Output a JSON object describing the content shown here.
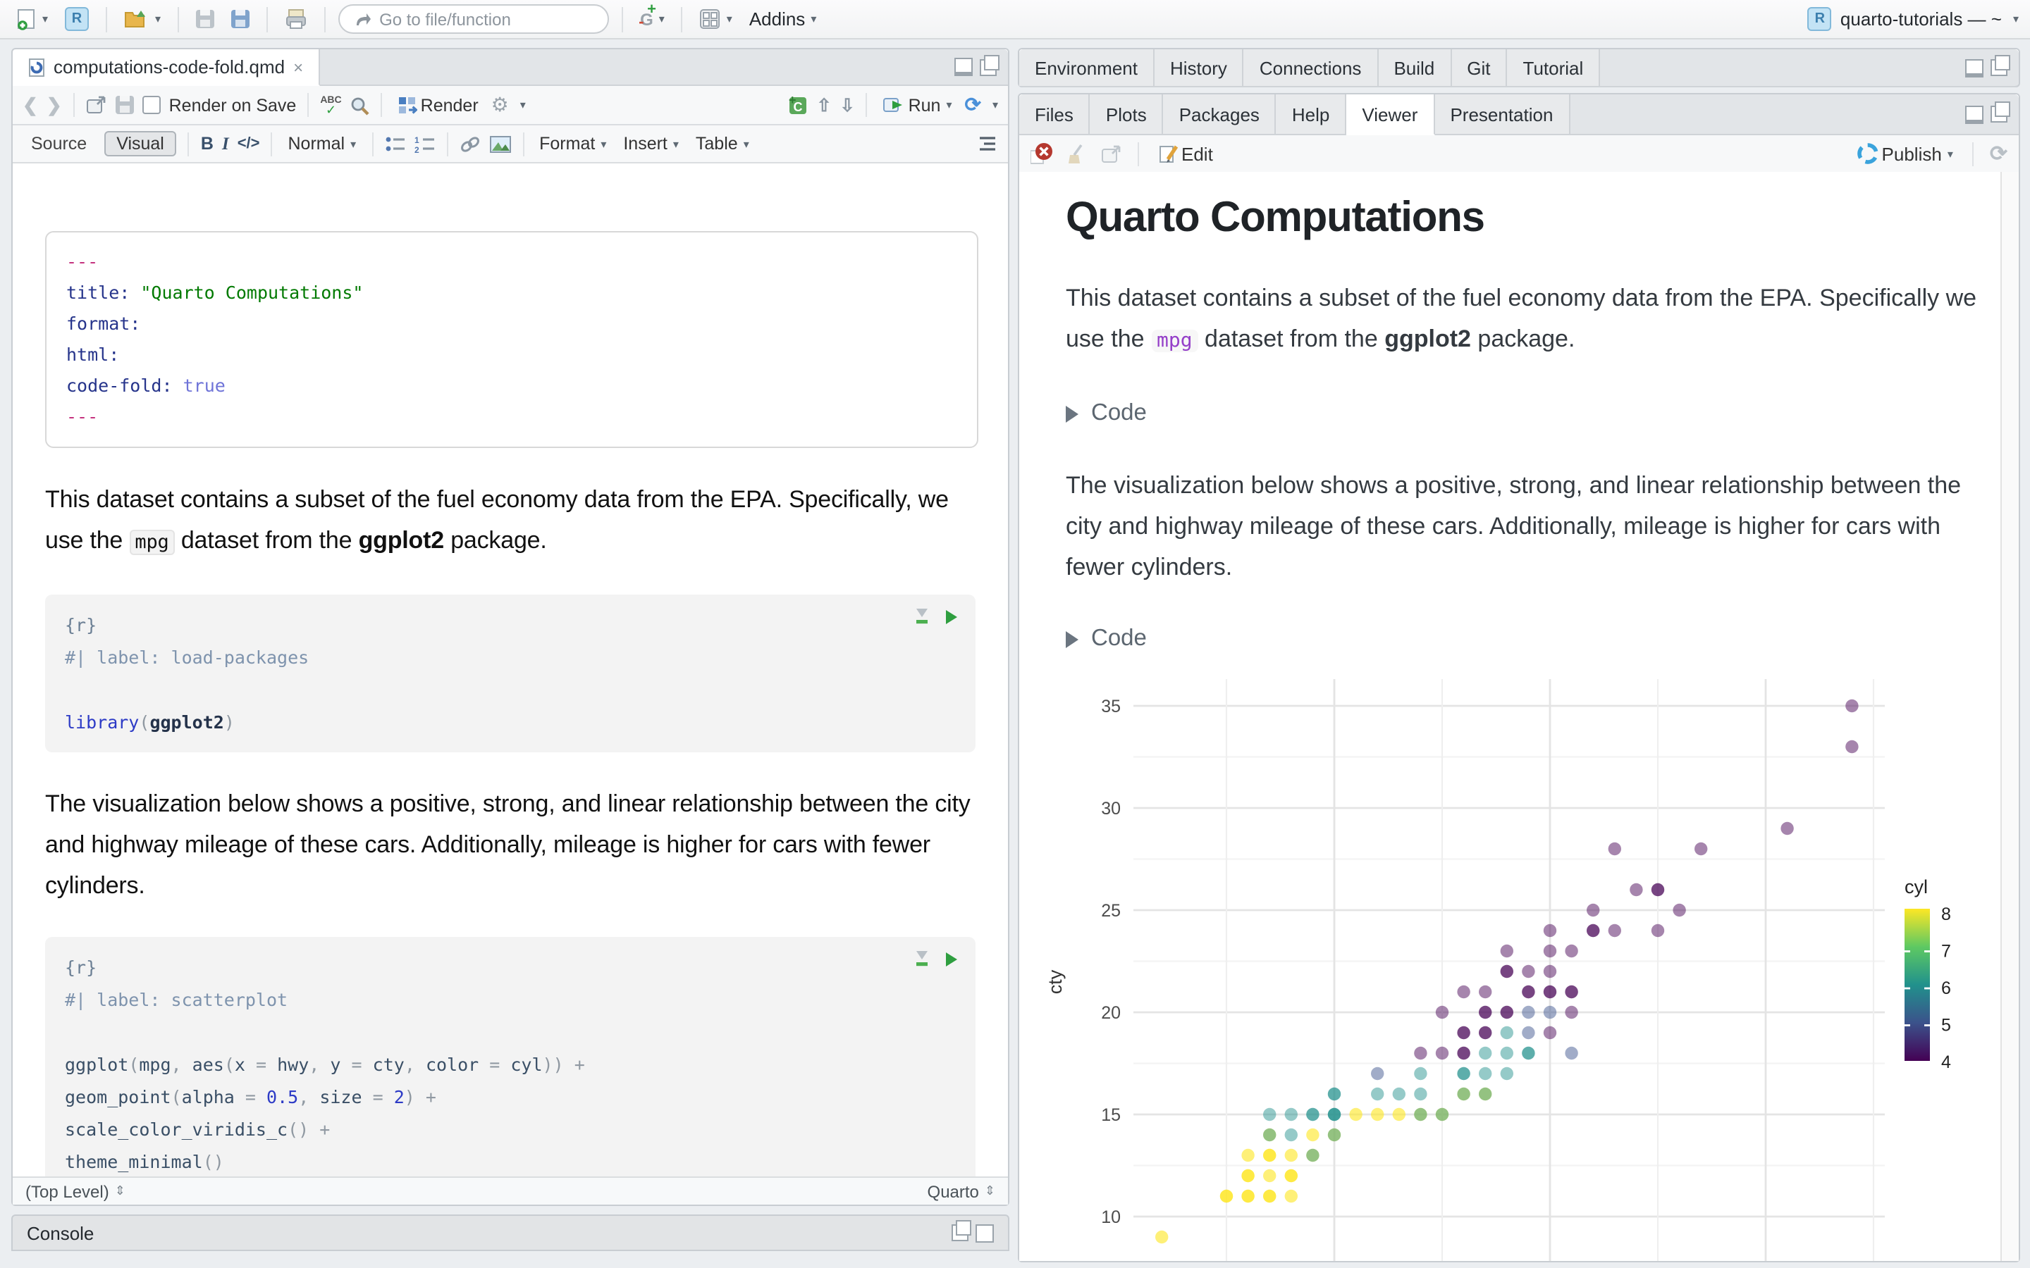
{
  "toolbar": {
    "goto_placeholder": "Go to file/function",
    "addins_label": "Addins",
    "project_label": "quarto-tutorials — ~"
  },
  "editor": {
    "tab_title": "computations-code-fold.qmd",
    "toolbar1": {
      "render_on_save": "Render on Save",
      "render": "Render",
      "run": "Run"
    },
    "toolbar2": {
      "source": "Source",
      "visual": "Visual",
      "bold": "B",
      "italic": "I",
      "code": "</>",
      "style": "Normal",
      "format": "Format",
      "insert": "Insert",
      "table": "Table"
    },
    "yaml_lines": [
      [
        {
          "t": "---",
          "c": "mg"
        }
      ],
      [
        {
          "t": "title: ",
          "c": "key"
        },
        {
          "t": "\"Quarto Computations\"",
          "c": "str"
        }
      ],
      [
        {
          "t": "format:",
          "c": "key"
        }
      ],
      [
        {
          "t": "  html:",
          "c": "key"
        }
      ],
      [
        {
          "t": "    code-fold: ",
          "c": "key"
        },
        {
          "t": "true",
          "c": "bool"
        }
      ],
      [
        {
          "t": "---",
          "c": "mg"
        }
      ]
    ],
    "para1": [
      {
        "t": "This dataset contains a subset of the fuel economy data from the EPA. Specifically, we use the "
      },
      {
        "t": "mpg",
        "s": "code"
      },
      {
        "t": " dataset from the "
      },
      {
        "t": "ggplot2",
        "s": "b"
      },
      {
        "t": " package."
      }
    ],
    "chunk1_lines": [
      [
        {
          "t": "{r}",
          "c": "hdr"
        }
      ],
      [
        {
          "t": "#| label: load-packages",
          "c": "cm"
        }
      ],
      [],
      [
        {
          "t": "library",
          "c": "fn"
        },
        {
          "t": "(",
          "c": "pa"
        },
        {
          "t": "ggplot2",
          "c": "idb"
        },
        {
          "t": ")",
          "c": "pa"
        }
      ]
    ],
    "para2": [
      {
        "t": "The visualization below shows a positive, strong, and linear relationship between the city and highway mileage of these cars. Additionally, mileage is higher for cars with fewer cylinders."
      }
    ],
    "chunk2_lines": [
      [
        {
          "t": "{r}",
          "c": "hdr"
        }
      ],
      [
        {
          "t": "#| label: scatterplot",
          "c": "cm"
        }
      ],
      [],
      [
        {
          "t": "ggplot",
          "c": "id"
        },
        {
          "t": "(",
          "c": "pa"
        },
        {
          "t": "mpg",
          "c": "id"
        },
        {
          "t": ", ",
          "c": "pa"
        },
        {
          "t": "aes",
          "c": "id"
        },
        {
          "t": "(",
          "c": "pa"
        },
        {
          "t": "x ",
          "c": "id"
        },
        {
          "t": "= ",
          "c": "op"
        },
        {
          "t": "hwy",
          "c": "id"
        },
        {
          "t": ", ",
          "c": "pa"
        },
        {
          "t": "y ",
          "c": "id"
        },
        {
          "t": "= ",
          "c": "op"
        },
        {
          "t": "cty",
          "c": "id"
        },
        {
          "t": ", ",
          "c": "pa"
        },
        {
          "t": "color ",
          "c": "id"
        },
        {
          "t": "= ",
          "c": "op"
        },
        {
          "t": "cyl",
          "c": "id"
        },
        {
          "t": ")) ",
          "c": "pa"
        },
        {
          "t": "+",
          "c": "op"
        }
      ],
      [
        {
          "t": "  geom_point",
          "c": "id"
        },
        {
          "t": "(",
          "c": "pa"
        },
        {
          "t": "alpha ",
          "c": "id"
        },
        {
          "t": "= ",
          "c": "op"
        },
        {
          "t": "0.5",
          "c": "num"
        },
        {
          "t": ", ",
          "c": "pa"
        },
        {
          "t": "size ",
          "c": "id"
        },
        {
          "t": "= ",
          "c": "op"
        },
        {
          "t": "2",
          "c": "num"
        },
        {
          "t": ") ",
          "c": "pa"
        },
        {
          "t": "+",
          "c": "op"
        }
      ],
      [
        {
          "t": "  scale_color_viridis_c",
          "c": "id"
        },
        {
          "t": "() ",
          "c": "pa"
        },
        {
          "t": "+",
          "c": "op"
        }
      ],
      [
        {
          "t": "  theme_minimal",
          "c": "id"
        },
        {
          "t": "()",
          "c": "pa"
        }
      ]
    ],
    "status_left": "(Top Level)",
    "status_right": "Quarto",
    "console_label": "Console"
  },
  "right_top": {
    "tabs": [
      "Environment",
      "History",
      "Connections",
      "Build",
      "Git",
      "Tutorial"
    ]
  },
  "right_bottom": {
    "tabs": [
      "Files",
      "Plots",
      "Packages",
      "Help",
      "Viewer",
      "Presentation"
    ],
    "active_tab": "Viewer",
    "viewer_toolbar": {
      "edit": "Edit",
      "publish": "Publish"
    }
  },
  "viewer": {
    "title": "Quarto Computations",
    "para1": [
      {
        "t": "This dataset contains a subset of the fuel economy data from the EPA. Specifically we use the "
      },
      {
        "t": "mpg",
        "s": "codep"
      },
      {
        "t": " dataset from the "
      },
      {
        "t": "ggplot2",
        "s": "b"
      },
      {
        "t": " package."
      }
    ],
    "folds": [
      "Code",
      "Code"
    ],
    "para2": [
      {
        "t": "The visualization below shows a positive, strong, and linear relationship between the city and highway mileage of these cars. Additionally, mileage is higher for cars with fewer cylinders."
      }
    ]
  },
  "chart_data": {
    "type": "scatter",
    "title": "",
    "xlabel": "",
    "ylabel": "cty",
    "x_note": "x axis is hwy; tick labels cut off below visible area",
    "ylim_visible": [
      7.3,
      36.3
    ],
    "xlim_visible": [
      10.7,
      45.3
    ],
    "y_ticks": [
      10,
      15,
      20,
      25,
      30,
      35
    ],
    "y_minor": [
      12.5,
      17.5,
      22.5,
      27.5,
      32.5
    ],
    "x_major_gridlines": [
      20,
      30,
      40
    ],
    "x_minor_gridlines": [
      15,
      25,
      35,
      45
    ],
    "grid": "on",
    "legend": {
      "title": "cyl",
      "position": "right",
      "ticks": [
        8,
        7,
        6,
        5,
        4
      ],
      "viridis_stops": [
        "#440154",
        "#3b528b",
        "#21918c",
        "#5ec962",
        "#fde725"
      ]
    },
    "cyl_colors": {
      "4": "#440154",
      "5": "#3b528b",
      "6": "#21918c",
      "8": "#fde725"
    },
    "point_alpha": 0.5,
    "points_hwy_cty_cyl": [
      [
        44,
        35,
        4
      ],
      [
        44,
        33,
        4
      ],
      [
        41,
        29,
        4
      ],
      [
        33,
        28,
        4
      ],
      [
        37,
        28,
        4
      ],
      [
        34,
        26,
        4
      ],
      [
        35,
        26,
        4
      ],
      [
        35,
        26,
        4
      ],
      [
        32,
        25,
        4
      ],
      [
        36,
        25,
        4
      ],
      [
        30,
        24,
        4
      ],
      [
        32,
        24,
        4
      ],
      [
        32,
        24,
        4
      ],
      [
        33,
        24,
        4
      ],
      [
        35,
        24,
        4
      ],
      [
        28,
        23,
        4
      ],
      [
        30,
        23,
        4
      ],
      [
        31,
        23,
        4
      ],
      [
        28,
        22,
        4
      ],
      [
        28,
        22,
        4
      ],
      [
        29,
        22,
        4
      ],
      [
        30,
        22,
        4
      ],
      [
        26,
        21,
        4
      ],
      [
        27,
        21,
        4
      ],
      [
        29,
        21,
        4
      ],
      [
        29,
        21,
        4
      ],
      [
        30,
        21,
        4
      ],
      [
        30,
        21,
        4
      ],
      [
        31,
        21,
        4
      ],
      [
        31,
        21,
        4
      ],
      [
        25,
        20,
        4
      ],
      [
        27,
        20,
        4
      ],
      [
        27,
        20,
        4
      ],
      [
        28,
        20,
        4
      ],
      [
        28,
        20,
        4
      ],
      [
        29,
        20,
        5
      ],
      [
        30,
        20,
        5
      ],
      [
        31,
        20,
        4
      ],
      [
        26,
        19,
        4
      ],
      [
        26,
        19,
        4
      ],
      [
        27,
        19,
        4
      ],
      [
        27,
        19,
        4
      ],
      [
        28,
        19,
        6
      ],
      [
        29,
        19,
        5
      ],
      [
        30,
        19,
        4
      ],
      [
        24,
        18,
        4
      ],
      [
        25,
        18,
        4
      ],
      [
        26,
        18,
        4
      ],
      [
        26,
        18,
        4
      ],
      [
        27,
        18,
        6
      ],
      [
        28,
        18,
        6
      ],
      [
        29,
        18,
        6
      ],
      [
        29,
        18,
        6
      ],
      [
        31,
        18,
        5
      ],
      [
        22,
        17,
        5
      ],
      [
        24,
        17,
        6
      ],
      [
        26,
        17,
        6
      ],
      [
        26,
        17,
        6
      ],
      [
        27,
        17,
        6
      ],
      [
        28,
        17,
        6
      ],
      [
        20,
        16,
        6
      ],
      [
        20,
        16,
        6
      ],
      [
        22,
        16,
        6
      ],
      [
        23,
        16,
        6
      ],
      [
        24,
        16,
        6
      ],
      [
        26,
        16,
        8
      ],
      [
        26,
        16,
        6
      ],
      [
        27,
        16,
        8
      ],
      [
        27,
        16,
        6
      ],
      [
        17,
        15,
        6
      ],
      [
        18,
        15,
        6
      ],
      [
        19,
        15,
        6
      ],
      [
        19,
        15,
        6
      ],
      [
        20,
        15,
        6
      ],
      [
        20,
        15,
        6
      ],
      [
        20,
        15,
        6
      ],
      [
        21,
        15,
        8
      ],
      [
        22,
        15,
        8
      ],
      [
        23,
        15,
        8
      ],
      [
        24,
        15,
        8
      ],
      [
        24,
        15,
        6
      ],
      [
        25,
        15,
        8
      ],
      [
        25,
        15,
        6
      ],
      [
        17,
        14,
        8
      ],
      [
        17,
        14,
        6
      ],
      [
        18,
        14,
        6
      ],
      [
        19,
        14,
        8
      ],
      [
        20,
        14,
        8
      ],
      [
        20,
        14,
        6
      ],
      [
        16,
        13,
        8
      ],
      [
        17,
        13,
        8
      ],
      [
        17,
        13,
        8
      ],
      [
        18,
        13,
        8
      ],
      [
        19,
        13,
        8
      ],
      [
        19,
        13,
        6
      ],
      [
        16,
        12,
        8
      ],
      [
        16,
        12,
        8
      ],
      [
        17,
        12,
        8
      ],
      [
        18,
        12,
        8
      ],
      [
        18,
        12,
        8
      ],
      [
        15,
        11,
        8
      ],
      [
        15,
        11,
        8
      ],
      [
        16,
        11,
        8
      ],
      [
        16,
        11,
        8
      ],
      [
        17,
        11,
        8
      ],
      [
        17,
        11,
        8
      ],
      [
        18,
        11,
        8
      ],
      [
        12,
        9,
        8
      ]
    ]
  }
}
